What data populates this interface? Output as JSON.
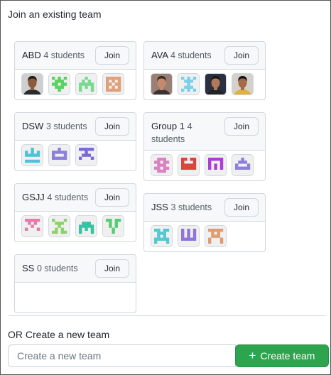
{
  "heading": "Join an existing team",
  "join_label": "Join",
  "teams_left": [
    {
      "name": "ABD",
      "count": "4 students",
      "members": [
        {
          "kind": "photo",
          "skin": "#8d5a3b",
          "hair": "#1e1a18",
          "bg": "#cfcfcf",
          "shirt": "#2b2b2b"
        },
        {
          "kind": "identicon",
          "color": "#58d35f",
          "pattern": "p1"
        },
        {
          "kind": "identicon",
          "color": "#79d98e",
          "pattern": "p2"
        },
        {
          "kind": "identicon",
          "color": "#e0a07a",
          "pattern": "p3"
        }
      ]
    },
    {
      "name": "DSW",
      "count": "3 students",
      "members": [
        {
          "kind": "identicon",
          "color": "#4fc2d8",
          "pattern": "p4"
        },
        {
          "kind": "identicon",
          "color": "#8c7fdc",
          "pattern": "p5"
        },
        {
          "kind": "identicon",
          "color": "#7a6ad6",
          "pattern": "p6"
        }
      ]
    },
    {
      "name": "GSJJ",
      "count": "4 students",
      "members": [
        {
          "kind": "identicon",
          "color": "#e77aa8",
          "pattern": "p7"
        },
        {
          "kind": "identicon",
          "color": "#8ad26a",
          "pattern": "p8"
        },
        {
          "kind": "identicon",
          "color": "#34c3a3",
          "pattern": "p9"
        },
        {
          "kind": "identicon",
          "color": "#58cc74",
          "pattern": "p10"
        }
      ]
    },
    {
      "name": "SS",
      "count": "0 students",
      "members": []
    }
  ],
  "teams_right": [
    {
      "name": "AVA",
      "count": "4 students",
      "members": [
        {
          "kind": "photo",
          "skin": "#c48a6e",
          "hair": "#3a2a22",
          "bg": "#9a7f74",
          "shirt": "#3e3230"
        },
        {
          "kind": "identicon",
          "color": "#79d0e8",
          "pattern": "p11"
        },
        {
          "kind": "photo",
          "skin": "#b07a5a",
          "hair": "#161616",
          "bg": "#2a3040",
          "shirt": "#222"
        },
        {
          "kind": "photo",
          "skin": "#a56a48",
          "hair": "#141010",
          "bg": "#d4d0cc",
          "shirt": "#e2b13c"
        }
      ]
    },
    {
      "name": "Group 1",
      "count": "4 students",
      "members": [
        {
          "kind": "identicon",
          "color": "#d982c2",
          "pattern": "p12"
        },
        {
          "kind": "identicon",
          "color": "#d9453a",
          "pattern": "p13"
        },
        {
          "kind": "identicon",
          "color": "#a93ed6",
          "pattern": "p14"
        },
        {
          "kind": "identicon",
          "color": "#8e7ede",
          "pattern": "p15"
        }
      ]
    },
    {
      "name": "JSS",
      "count": "3 students",
      "members": [
        {
          "kind": "identicon",
          "color": "#54c8d2",
          "pattern": "p16"
        },
        {
          "kind": "identicon",
          "color": "#8f74dc",
          "pattern": "p17"
        },
        {
          "kind": "identicon",
          "color": "#e09c70",
          "pattern": "p18"
        }
      ]
    }
  ],
  "create": {
    "label": "OR Create a new team",
    "placeholder": "Create a new team",
    "button_label": "Create team",
    "button_icon": "plus-icon",
    "accent": "#2da44e"
  }
}
